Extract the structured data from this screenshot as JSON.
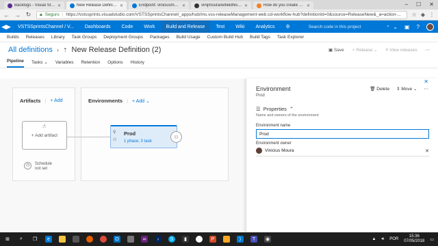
{
  "browser": {
    "tabs": [
      {
        "label": "Backlogs - Visual Studio",
        "color": "#5c2d91",
        "active": false
      },
      {
        "label": "New Release Definition",
        "color": "#0078d7",
        "active": true
      },
      {
        "label": "Endpoint: viniciusmoura",
        "color": "#0078d7",
        "active": false
      },
      {
        "label": "vinijmoura/wifieldhistor",
        "color": "#333333",
        "active": false
      },
      {
        "label": "How do you create a rel",
        "color": "#f48024",
        "active": false
      }
    ],
    "secure_label": "Seguro",
    "url": "https://vstssprints.visualstudio.com/VSTSSprintsChannel/_apps/hub/ms.vss-releaseManagement-web.cd-workflow-hub?definitionId=0&source=ReleaseNew&_a=action-..."
  },
  "topnav": {
    "project": "VSTSSprintsChannel / V...",
    "hubs": [
      "Dashboards",
      "Code",
      "Work",
      "Build and Release",
      "Test",
      "Wiki",
      "Analytics"
    ],
    "active_hub": "Build and Release",
    "search_placeholder": "Search code in this project"
  },
  "subnav": [
    "Builds",
    "Releases",
    "Library",
    "Task Groups",
    "Deployment Groups",
    "Packages",
    "Build Usage",
    "Custom Build Hub",
    "Build Tags",
    "Task Explorer"
  ],
  "titlebar": {
    "breadcrumb": "All definitions",
    "separator": "›",
    "title": "New Release Definition (2)",
    "save": "Save",
    "release": "Release",
    "view_releases": "View releases"
  },
  "pipeline_tabs": [
    "Pipeline",
    "Tasks",
    "Variables",
    "Retention",
    "Options",
    "History"
  ],
  "active_pipeline_tab": "Pipeline",
  "artifacts": {
    "heading": "Artifacts",
    "add": "Add",
    "card_label": "Add artifact",
    "schedule_line1": "Schedule",
    "schedule_line2": "not set"
  },
  "environments": {
    "heading": "Environments",
    "add": "Add",
    "stage_name": "Prod",
    "stage_meta": "1 phase, 0 task"
  },
  "panel": {
    "title": "Environment",
    "subtitle": "Prod",
    "delete": "Delete",
    "move": "Move",
    "section": "Properties",
    "section_desc": "Name and owners of the environment",
    "name_label": "Environment name",
    "name_value": "Prod",
    "owner_label": "Environment owner",
    "owner_value": "Vinicius Moura"
  },
  "taskbar": {
    "lang": "POR",
    "time": "15:36",
    "date": "07/05/2018"
  },
  "colors": {
    "accent": "#0078d7",
    "topnav": "#0078d7",
    "stage_fill": "#deecf9"
  }
}
